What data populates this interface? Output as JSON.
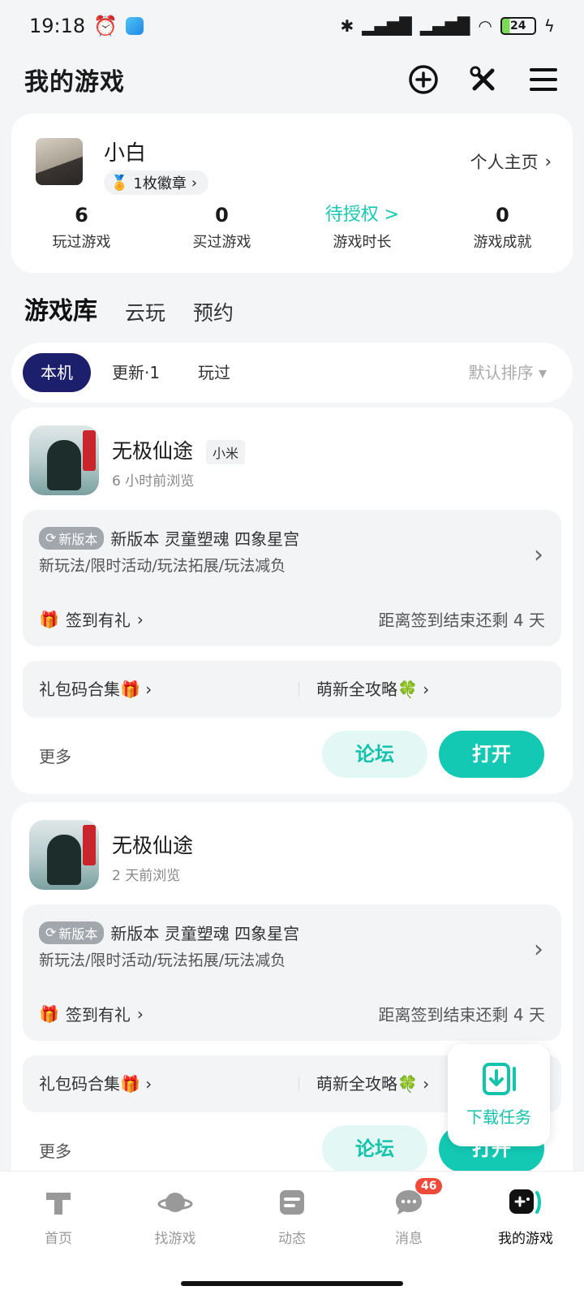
{
  "status_bar": {
    "time": "19:18",
    "battery": "24"
  },
  "header": {
    "title": "我的游戏"
  },
  "profile": {
    "name": "小白",
    "badge": "1枚徽章",
    "homepage": "个人主页",
    "stats": [
      {
        "value": "6",
        "label": "玩过游戏"
      },
      {
        "value": "0",
        "label": "买过游戏"
      },
      {
        "value": "待授权 >",
        "label": "游戏时长"
      },
      {
        "value": "0",
        "label": "游戏成就"
      }
    ]
  },
  "tabs": [
    "游戏库",
    "云玩",
    "预约"
  ],
  "filters": {
    "chips": [
      "本机",
      "更新·1",
      "玩过"
    ],
    "sort": "默认排序 ▾"
  },
  "games": [
    {
      "name": "无极仙途",
      "source": "小米",
      "viewed": "6 小时前浏览",
      "new_tag": "新版本",
      "new_title": "新版本 灵童塑魂 四象星宫",
      "new_desc": "新玩法/限时活动/玩法拓展/玩法减负",
      "sign": "签到有礼",
      "remain": "距离签到结束还剩 4 天",
      "link_left": "礼包码合集🎁",
      "link_right": "萌新全攻略🍀",
      "more": "更多",
      "forum": "论坛",
      "open": "打开"
    },
    {
      "name": "无极仙途",
      "source": "",
      "viewed": "2 天前浏览",
      "new_tag": "新版本",
      "new_title": "新版本 灵童塑魂 四象星宫",
      "new_desc": "新玩法/限时活动/玩法拓展/玩法减负",
      "sign": "签到有礼",
      "remain": "距离签到结束还剩 4 天",
      "link_left": "礼包码合集🎁",
      "link_right": "萌新全攻略🍀",
      "more": "更多",
      "forum": "论坛",
      "open": "打开"
    }
  ],
  "download_task": "下载任务",
  "bottom_nav": {
    "items": [
      {
        "label": "首页",
        "icon": "taptap-home-icon"
      },
      {
        "label": "找游戏",
        "icon": "planet-icon"
      },
      {
        "label": "动态",
        "icon": "feed-icon"
      },
      {
        "label": "消息",
        "icon": "chat-icon",
        "badge": "46"
      },
      {
        "label": "我的游戏",
        "icon": "gamepad-icon"
      }
    ]
  },
  "colors": {
    "accent": "#14c9b4",
    "chip_active": "#1c1f6b",
    "badge_red": "#f04a3b"
  }
}
